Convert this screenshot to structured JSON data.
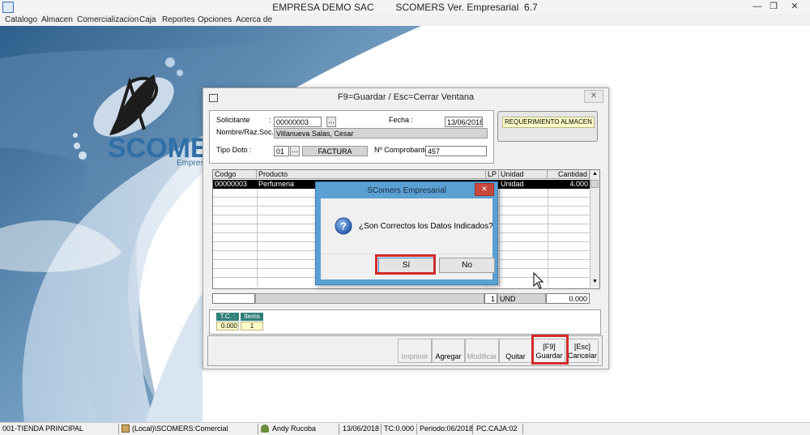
{
  "window": {
    "title": "EMPRESA DEMO SAC        SCOMERS Ver. Empresarial  6.7",
    "minimize": "—",
    "maximize": "❐",
    "close": "✕"
  },
  "menu": [
    "Catalogo",
    "Almacen",
    "Comercializacion",
    "Caja",
    "Reportes",
    "Opciones",
    "Acerca de"
  ],
  "background": {
    "brand": "SCOMER",
    "sub": "Empres",
    "logo_letters": "RA"
  },
  "form": {
    "title": "F9=Guardar / Esc=Cerrar Ventana",
    "solicitante_label": "Solicitante",
    "solicitante_value": "00000003",
    "fecha_label": "Fecha :",
    "fecha_value": "13/06/2018",
    "nombre_label": "Nombre/Raz.Soc. :",
    "nombre_value": "Villanueva  Salas, Cesar",
    "tipo_doc_label": "Tipo Doto :",
    "tipo_doc_code": "01",
    "tipo_doc_name": "FACTURA",
    "comprobante_label": "Nº Comprobante :",
    "comprobante_value": "457",
    "doc_type_badge": "REQUERIMIENTO ALMACEN",
    "ellipsis": "...",
    "colon": ":"
  },
  "grid": {
    "headers": [
      "Codgo",
      "Producto",
      "LP",
      "Unidad",
      "Cantidad"
    ],
    "rows": [
      {
        "codigo": "00000003",
        "producto": "Perfumeria",
        "lp": "",
        "unidad": "Unidad",
        "cantidad": "4.000"
      }
    ],
    "footer": {
      "lp": "1",
      "unidad": "UND",
      "cantidad": "0.000"
    }
  },
  "summary": {
    "tc_label": "T.C. :",
    "items_label": "Items",
    "tc_value": "0.000",
    "items_value": "1"
  },
  "toolbar": {
    "imprimir": "Imprimir",
    "agregar": "Agregar",
    "modificar": "Modificar",
    "quitar": "Quitar",
    "guardar_key": "[F9]",
    "guardar": "Guardar",
    "cancelar_key": "[Esc]",
    "cancelar": "Cancelar"
  },
  "dialog": {
    "title": "SComers Empresarial",
    "message": "¿Son Correctos los Datos Indicados?",
    "yes": "Sí",
    "no": "No",
    "close": "✕"
  },
  "statusbar": {
    "tienda": "001-TIENDA PRINCIPAL",
    "server": "(Local)\\SCOMERS:Comercial",
    "user": "Andy Rucoba",
    "date": "13/06/2018",
    "tc": "TC:0.000",
    "periodo": "Periodo:06/2018",
    "pc": "PC.CAJA:02"
  },
  "colors": {
    "highlight": "#d12a2a",
    "dialog_frame": "#5aa0d3",
    "selected_row": "#000000",
    "badge": "#ffffc8",
    "brand_blue": "#2f6fa7"
  }
}
